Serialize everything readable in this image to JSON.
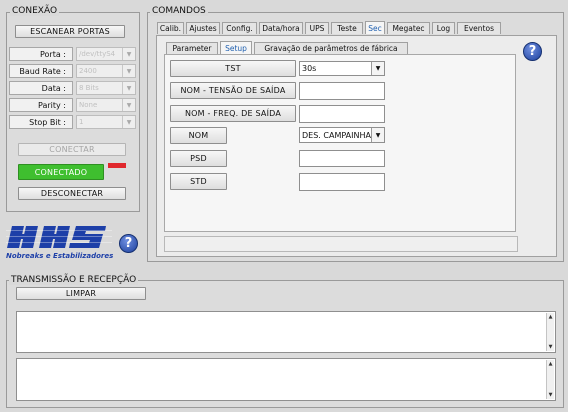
{
  "conexao": {
    "title": "CONEXÃO",
    "scan_button": "ESCANEAR PORTAS",
    "fields": [
      {
        "label": "Porta :",
        "value": "/dev/ttyS4"
      },
      {
        "label": "Baud Rate :",
        "value": "2400"
      },
      {
        "label": "Data :",
        "value": "8 Bits"
      },
      {
        "label": "Parity :",
        "value": "None"
      },
      {
        "label": "Stop Bit :",
        "value": "1"
      }
    ],
    "connect_button": "CONECTAR",
    "status_button": "CONECTADO",
    "disconnect_button": "DESCONECTAR",
    "status_indicator_color": "#e0282d"
  },
  "logo": {
    "name": "NHS",
    "tagline": "Nobreaks e Estabilizadores",
    "color": "#1d3fa8"
  },
  "comandos": {
    "title": "COMANDOS",
    "tabs": [
      "Calib.",
      "Ajustes",
      "Config.",
      "Data/hora",
      "UPS",
      "Teste",
      "Sec",
      "Megatec",
      "Log",
      "Eventos"
    ],
    "active_tab": "Sec",
    "subtabs": [
      "Parameter",
      "Setup",
      "Gravação de parâmetros de fábrica"
    ],
    "active_subtab": "Setup",
    "rows": {
      "tst": {
        "button": "TST",
        "select_value": "30s"
      },
      "nom_tensao": {
        "button": "NOM - TENSÃO DE SAÍDA",
        "value": ""
      },
      "nom_freq": {
        "button": "NOM - FREQ. DE SAÍDA",
        "value": ""
      },
      "nom": {
        "button": "NOM",
        "select_value": "DES. CAMPAINHA"
      },
      "psd": {
        "button": "PSD",
        "value": ""
      },
      "std": {
        "button": "STD",
        "value": ""
      }
    },
    "status_value": ""
  },
  "transmissao": {
    "title": "TRANSMISSÃO E RECEPÇÃO",
    "clear_button": "LIMPAR",
    "tx_text": "",
    "rx_text": ""
  },
  "help_icon": "question-mark-icon"
}
